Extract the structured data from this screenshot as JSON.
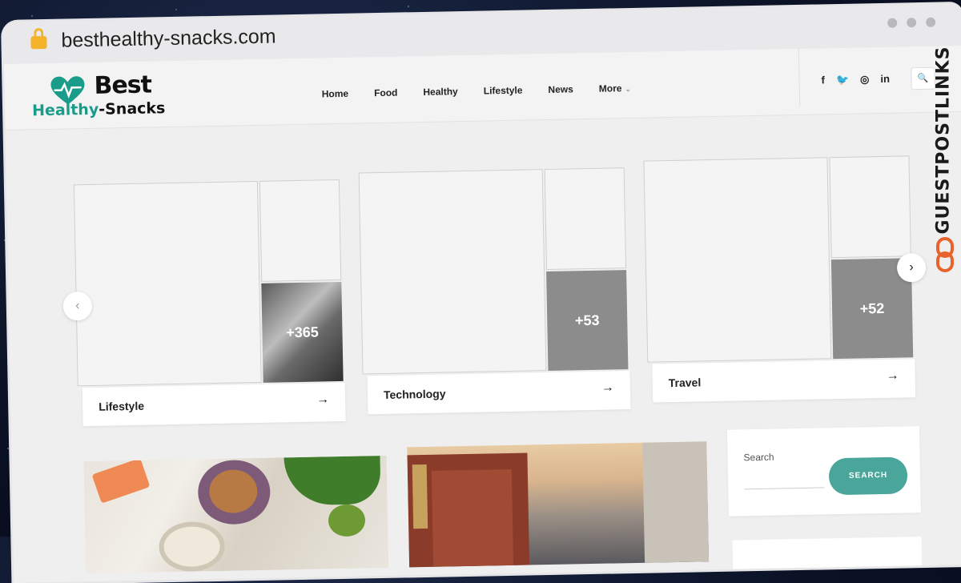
{
  "browser": {
    "url": "besthealthy-snacks.com"
  },
  "site": {
    "logo_word1": "Best",
    "logo_word2a": "Healthy",
    "logo_word2b": "-Snacks"
  },
  "nav": {
    "items": [
      "Home",
      "Food",
      "Healthy",
      "Lifestyle",
      "News",
      "More"
    ]
  },
  "social": [
    "f",
    "t",
    "ig",
    "in"
  ],
  "categories": [
    {
      "label": "Lifestyle",
      "count": "+365"
    },
    {
      "label": "Technology",
      "count": "+53"
    },
    {
      "label": "Travel",
      "count": "+52"
    }
  ],
  "sidebar": {
    "search_label": "Search",
    "search_button": "SEARCH"
  },
  "overlay": {
    "brand": "GUESTPOSTLINKS"
  },
  "colors": {
    "accent": "#4aa59b",
    "logo_green": "#1a9c8a",
    "brand_orange": "#e8632b"
  }
}
